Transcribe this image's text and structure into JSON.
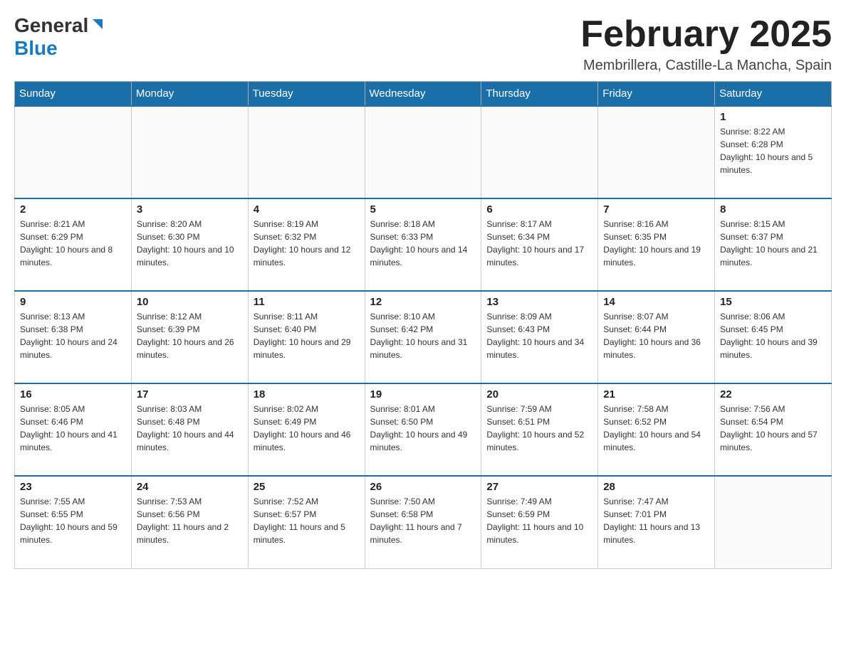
{
  "header": {
    "logo_general": "General",
    "logo_blue": "Blue",
    "month_title": "February 2025",
    "location": "Membrillera, Castille-La Mancha, Spain"
  },
  "weekdays": [
    "Sunday",
    "Monday",
    "Tuesday",
    "Wednesday",
    "Thursday",
    "Friday",
    "Saturday"
  ],
  "weeks": [
    [
      {
        "day": "",
        "info": ""
      },
      {
        "day": "",
        "info": ""
      },
      {
        "day": "",
        "info": ""
      },
      {
        "day": "",
        "info": ""
      },
      {
        "day": "",
        "info": ""
      },
      {
        "day": "",
        "info": ""
      },
      {
        "day": "1",
        "info": "Sunrise: 8:22 AM\nSunset: 6:28 PM\nDaylight: 10 hours and 5 minutes."
      }
    ],
    [
      {
        "day": "2",
        "info": "Sunrise: 8:21 AM\nSunset: 6:29 PM\nDaylight: 10 hours and 8 minutes."
      },
      {
        "day": "3",
        "info": "Sunrise: 8:20 AM\nSunset: 6:30 PM\nDaylight: 10 hours and 10 minutes."
      },
      {
        "day": "4",
        "info": "Sunrise: 8:19 AM\nSunset: 6:32 PM\nDaylight: 10 hours and 12 minutes."
      },
      {
        "day": "5",
        "info": "Sunrise: 8:18 AM\nSunset: 6:33 PM\nDaylight: 10 hours and 14 minutes."
      },
      {
        "day": "6",
        "info": "Sunrise: 8:17 AM\nSunset: 6:34 PM\nDaylight: 10 hours and 17 minutes."
      },
      {
        "day": "7",
        "info": "Sunrise: 8:16 AM\nSunset: 6:35 PM\nDaylight: 10 hours and 19 minutes."
      },
      {
        "day": "8",
        "info": "Sunrise: 8:15 AM\nSunset: 6:37 PM\nDaylight: 10 hours and 21 minutes."
      }
    ],
    [
      {
        "day": "9",
        "info": "Sunrise: 8:13 AM\nSunset: 6:38 PM\nDaylight: 10 hours and 24 minutes."
      },
      {
        "day": "10",
        "info": "Sunrise: 8:12 AM\nSunset: 6:39 PM\nDaylight: 10 hours and 26 minutes."
      },
      {
        "day": "11",
        "info": "Sunrise: 8:11 AM\nSunset: 6:40 PM\nDaylight: 10 hours and 29 minutes."
      },
      {
        "day": "12",
        "info": "Sunrise: 8:10 AM\nSunset: 6:42 PM\nDaylight: 10 hours and 31 minutes."
      },
      {
        "day": "13",
        "info": "Sunrise: 8:09 AM\nSunset: 6:43 PM\nDaylight: 10 hours and 34 minutes."
      },
      {
        "day": "14",
        "info": "Sunrise: 8:07 AM\nSunset: 6:44 PM\nDaylight: 10 hours and 36 minutes."
      },
      {
        "day": "15",
        "info": "Sunrise: 8:06 AM\nSunset: 6:45 PM\nDaylight: 10 hours and 39 minutes."
      }
    ],
    [
      {
        "day": "16",
        "info": "Sunrise: 8:05 AM\nSunset: 6:46 PM\nDaylight: 10 hours and 41 minutes."
      },
      {
        "day": "17",
        "info": "Sunrise: 8:03 AM\nSunset: 6:48 PM\nDaylight: 10 hours and 44 minutes."
      },
      {
        "day": "18",
        "info": "Sunrise: 8:02 AM\nSunset: 6:49 PM\nDaylight: 10 hours and 46 minutes."
      },
      {
        "day": "19",
        "info": "Sunrise: 8:01 AM\nSunset: 6:50 PM\nDaylight: 10 hours and 49 minutes."
      },
      {
        "day": "20",
        "info": "Sunrise: 7:59 AM\nSunset: 6:51 PM\nDaylight: 10 hours and 52 minutes."
      },
      {
        "day": "21",
        "info": "Sunrise: 7:58 AM\nSunset: 6:52 PM\nDaylight: 10 hours and 54 minutes."
      },
      {
        "day": "22",
        "info": "Sunrise: 7:56 AM\nSunset: 6:54 PM\nDaylight: 10 hours and 57 minutes."
      }
    ],
    [
      {
        "day": "23",
        "info": "Sunrise: 7:55 AM\nSunset: 6:55 PM\nDaylight: 10 hours and 59 minutes."
      },
      {
        "day": "24",
        "info": "Sunrise: 7:53 AM\nSunset: 6:56 PM\nDaylight: 11 hours and 2 minutes."
      },
      {
        "day": "25",
        "info": "Sunrise: 7:52 AM\nSunset: 6:57 PM\nDaylight: 11 hours and 5 minutes."
      },
      {
        "day": "26",
        "info": "Sunrise: 7:50 AM\nSunset: 6:58 PM\nDaylight: 11 hours and 7 minutes."
      },
      {
        "day": "27",
        "info": "Sunrise: 7:49 AM\nSunset: 6:59 PM\nDaylight: 11 hours and 10 minutes."
      },
      {
        "day": "28",
        "info": "Sunrise: 7:47 AM\nSunset: 7:01 PM\nDaylight: 11 hours and 13 minutes."
      },
      {
        "day": "",
        "info": ""
      }
    ]
  ]
}
